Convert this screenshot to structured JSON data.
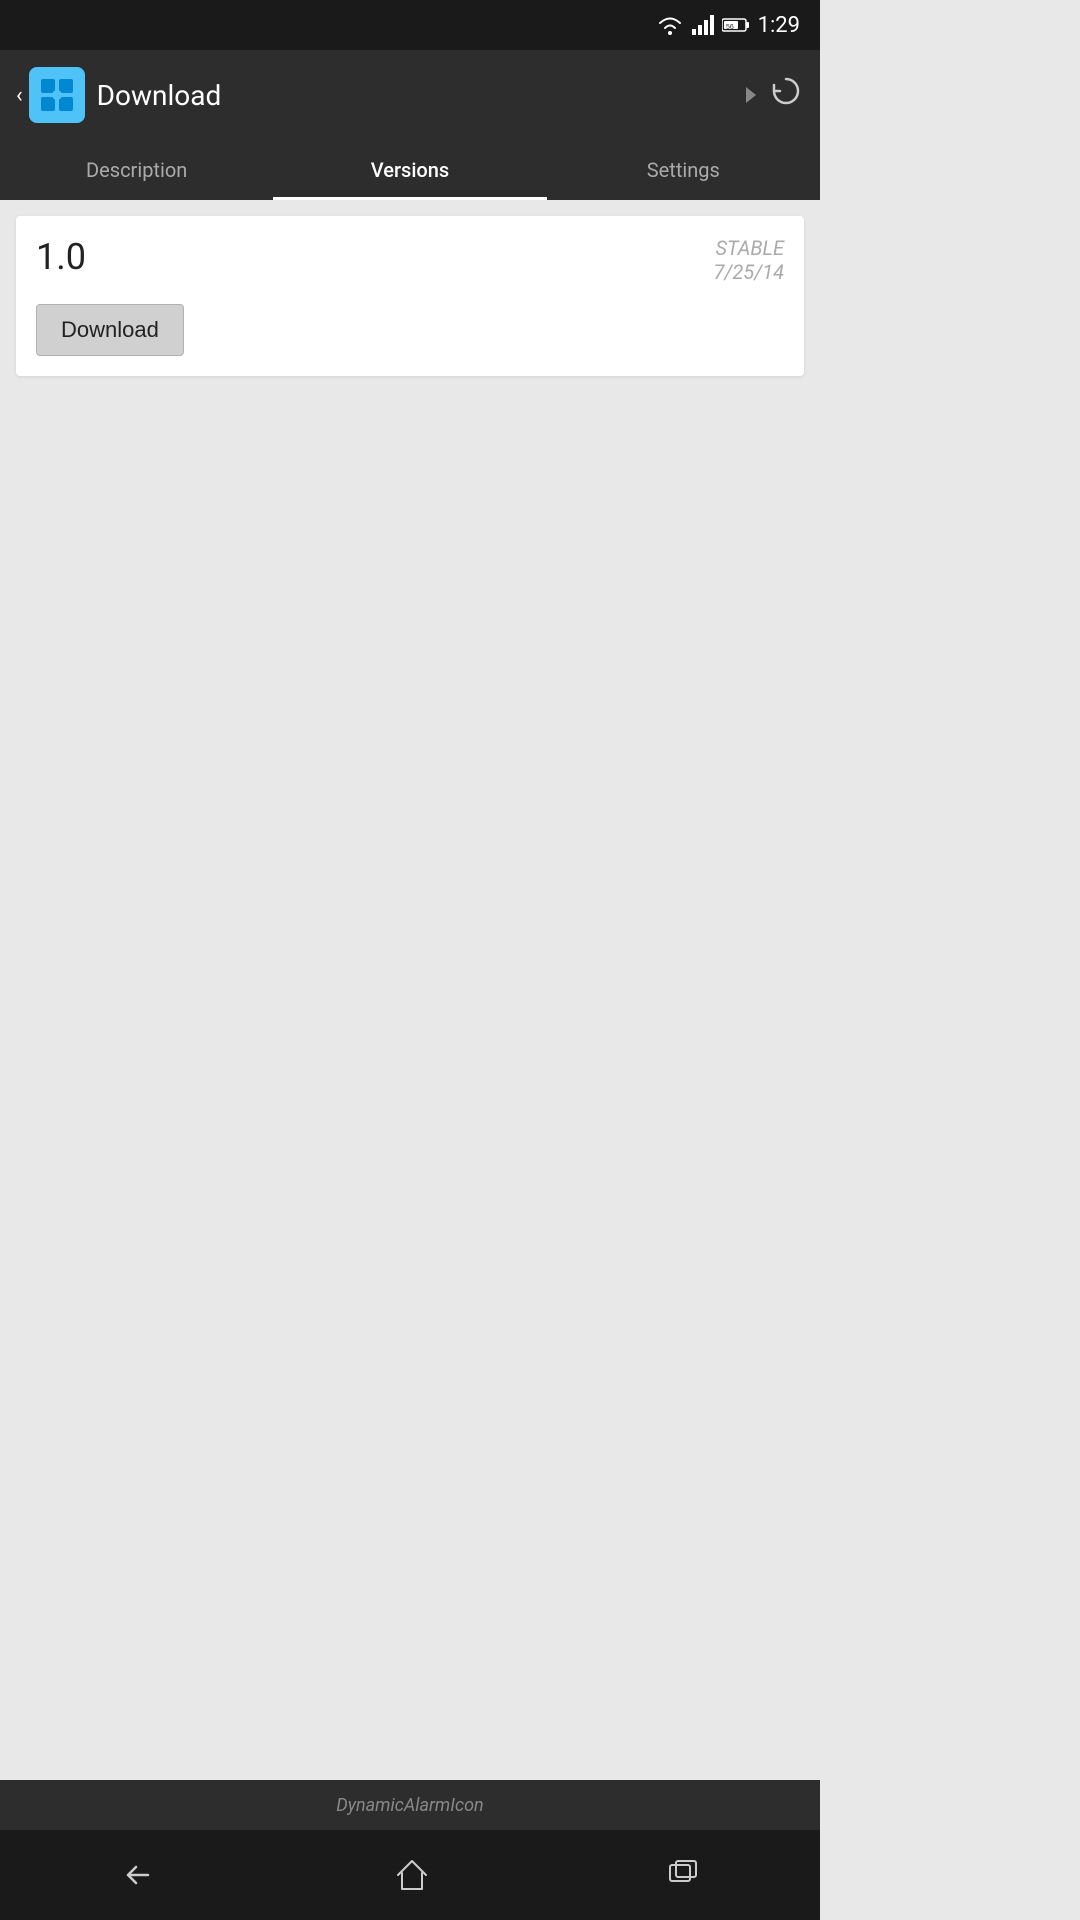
{
  "status_bar": {
    "time": "1:29",
    "battery_label": "56"
  },
  "app_bar": {
    "title": "Download",
    "refresh_icon": "refresh-icon",
    "back_icon": "back-icon",
    "app_icon": "puzzle-icon"
  },
  "tabs": [
    {
      "label": "Description",
      "active": false,
      "id": "description"
    },
    {
      "label": "Versions",
      "active": true,
      "id": "versions"
    },
    {
      "label": "Settings",
      "active": false,
      "id": "settings"
    }
  ],
  "version_card": {
    "version_number": "1.0",
    "stability": "STABLE",
    "date": "7/25/14",
    "download_button_label": "Download"
  },
  "bottom_bar": {
    "app_name": "DynamicAlarmIcon"
  },
  "nav_bar": {
    "back_icon": "nav-back-icon",
    "home_icon": "nav-home-icon",
    "recents_icon": "nav-recents-icon"
  }
}
